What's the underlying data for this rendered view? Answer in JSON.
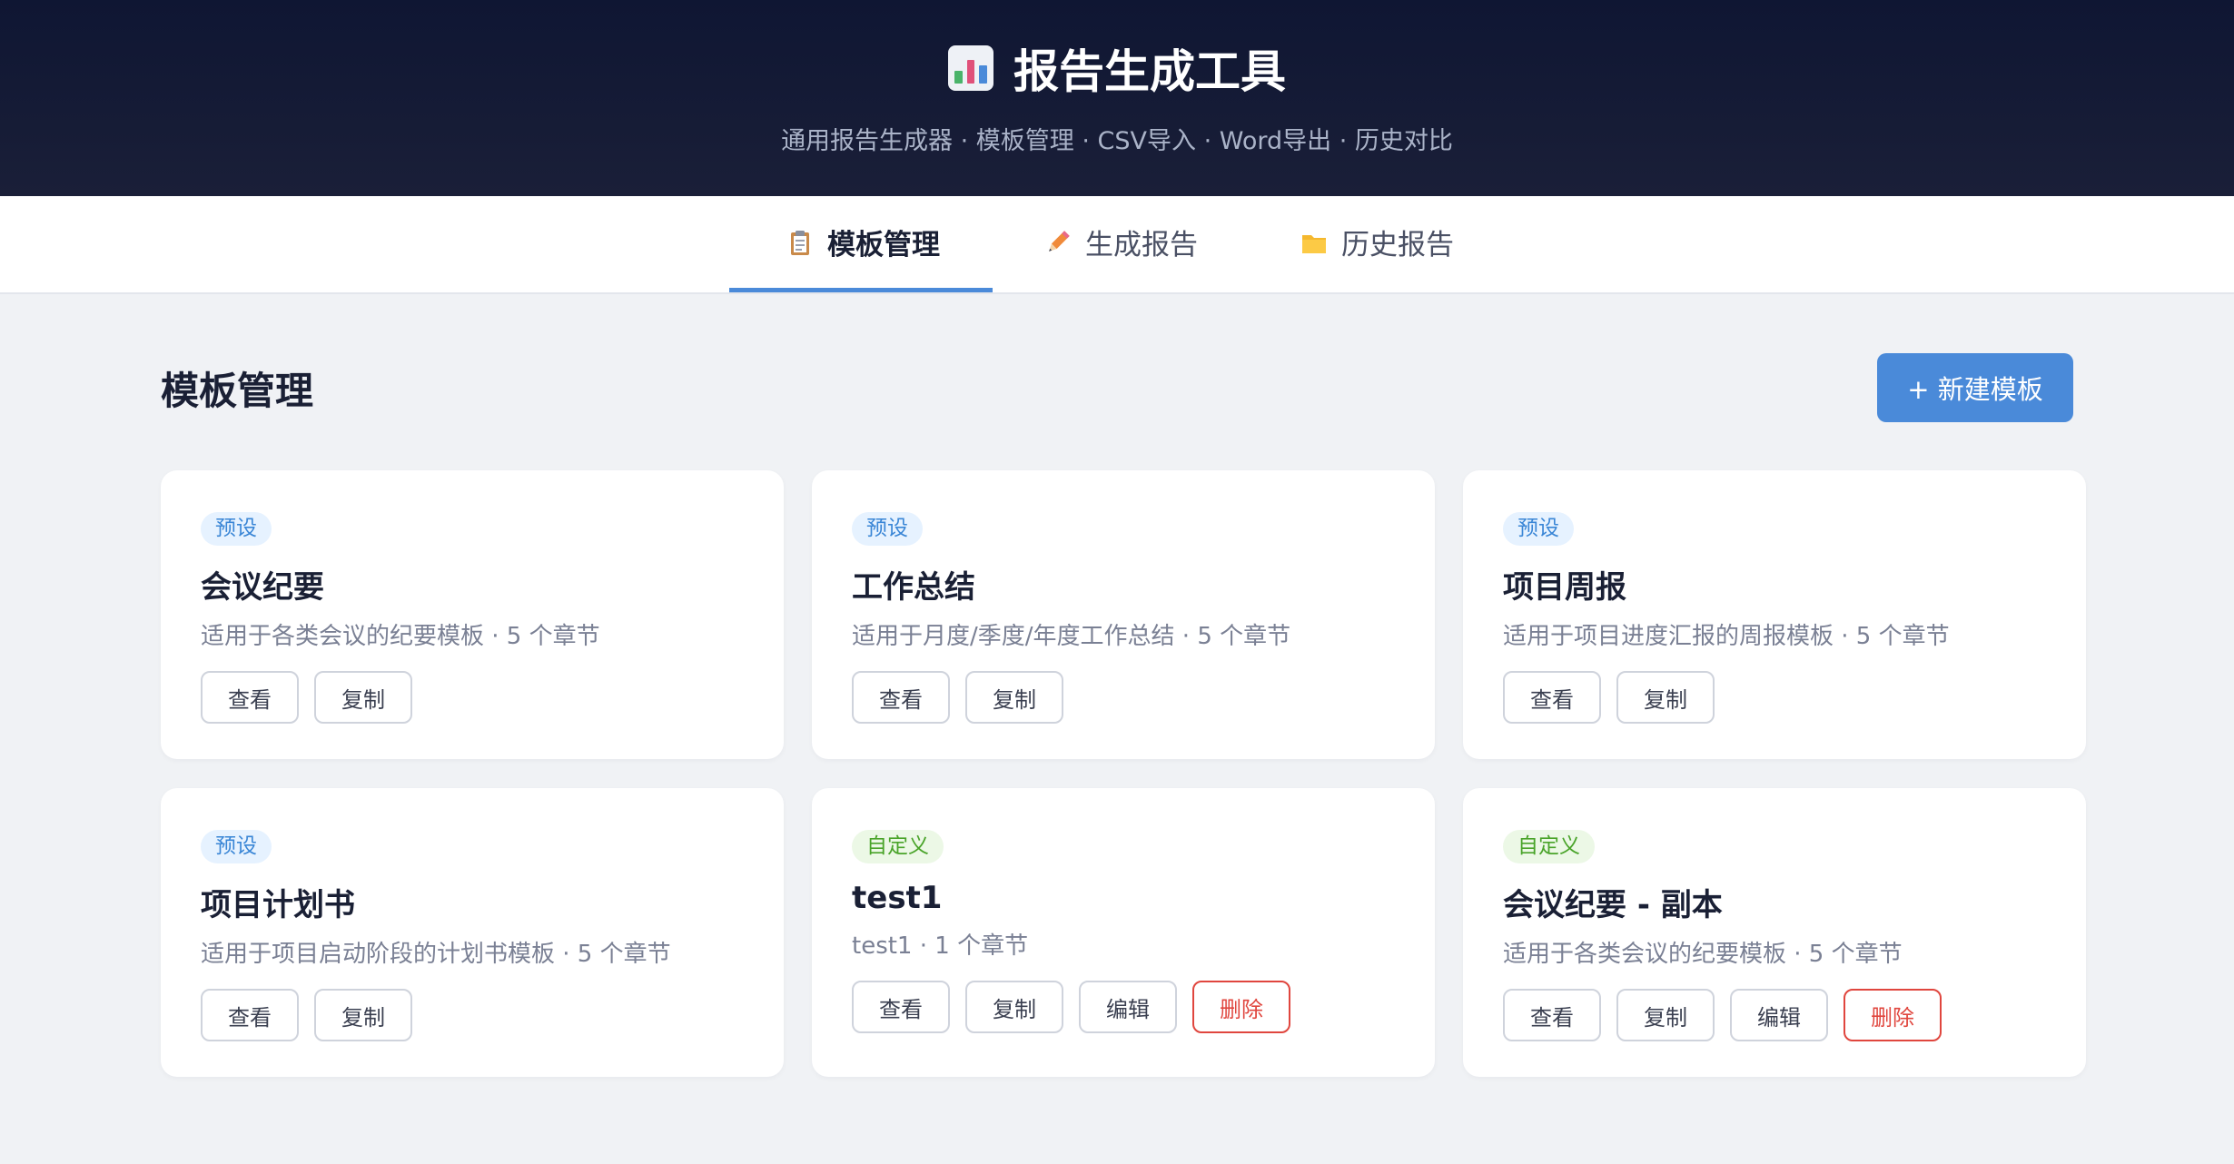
{
  "header": {
    "title": "报告生成工具",
    "subtitle": "通用报告生成器 · 模板管理 · CSV导入 · Word导出 · 历史对比",
    "icon": "bar-chart-icon"
  },
  "tabs": [
    {
      "label": "模板管理",
      "icon": "clipboard-icon",
      "active": true
    },
    {
      "label": "生成报告",
      "icon": "pencil-icon",
      "active": false
    },
    {
      "label": "历史报告",
      "icon": "folder-icon",
      "active": false
    }
  ],
  "section": {
    "title": "模板管理",
    "new_button": "+ 新建模板"
  },
  "buttons": {
    "view": "查看",
    "copy": "复制",
    "edit": "编辑",
    "delete": "删除"
  },
  "cards": [
    {
      "badge": "预设",
      "badge_type": "preset",
      "title": "会议纪要",
      "desc": "适用于各类会议的纪要模板 · 5 个章节"
    },
    {
      "badge": "预设",
      "badge_type": "preset",
      "title": "工作总结",
      "desc": "适用于月度/季度/年度工作总结 · 5 个章节"
    },
    {
      "badge": "预设",
      "badge_type": "preset",
      "title": "项目周报",
      "desc": "适用于项目进度汇报的周报模板 · 5 个章节"
    },
    {
      "badge": "预设",
      "badge_type": "preset",
      "title": "项目计划书",
      "desc": "适用于项目启动阶段的计划书模板 · 5 个章节"
    },
    {
      "badge": "自定义",
      "badge_type": "custom",
      "title": "test1",
      "desc": "test1 · 1 个章节"
    },
    {
      "badge": "自定义",
      "badge_type": "custom",
      "title": "会议纪要 - 副本",
      "desc": "适用于各类会议的纪要模板 · 5 个章节"
    }
  ],
  "colors": {
    "accent": "#4a8ad9",
    "danger": "#e0463e",
    "header_bg": "#0f1633",
    "preset_badge": "#3a86d6",
    "custom_badge": "#4aa42a"
  }
}
